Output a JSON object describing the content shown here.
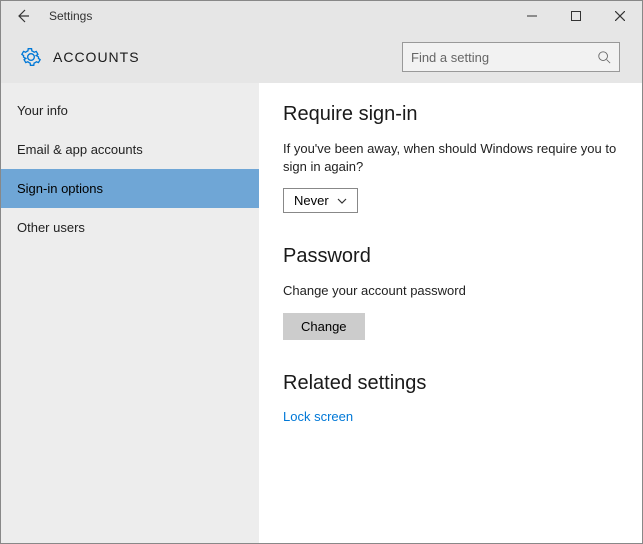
{
  "window": {
    "title": "Settings"
  },
  "header": {
    "section_label": "ACCOUNTS",
    "search_placeholder": "Find a setting"
  },
  "sidebar": {
    "items": [
      {
        "label": "Your info"
      },
      {
        "label": "Email & app accounts"
      },
      {
        "label": "Sign-in options"
      },
      {
        "label": "Other users"
      }
    ],
    "active_index": 2
  },
  "content": {
    "require_signin": {
      "heading": "Require sign-in",
      "description": "If you've been away, when should Windows require you to sign in again?",
      "selected": "Never"
    },
    "password": {
      "heading": "Password",
      "description": "Change your account password",
      "button": "Change"
    },
    "related": {
      "heading": "Related settings",
      "link": "Lock screen"
    }
  }
}
